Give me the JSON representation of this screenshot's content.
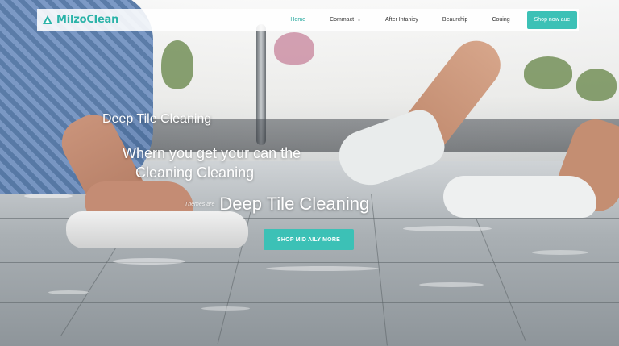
{
  "brand": {
    "name": "MilzoClean",
    "accent": "#3cc1b6"
  },
  "nav": {
    "items": [
      {
        "label": "Home",
        "active": true
      },
      {
        "label": "Commact",
        "dropdown": true
      },
      {
        "label": "After Intanicy"
      },
      {
        "label": "Beaurchip"
      },
      {
        "label": "Couing"
      }
    ],
    "cta_label": "Shop now auc"
  },
  "hero": {
    "label": "Deep Tile Cleaning",
    "title_line1": "Whern you get your can the",
    "title_line2": "Cleaning Cleaning",
    "sub_small": "Themes are",
    "sub_big": "Deep Tile Cleaning",
    "cta_label": "SHOP MID AILY MORE"
  },
  "icons": {
    "logo": "triangle-logo-icon",
    "dropdown": "chevron-down-icon"
  }
}
